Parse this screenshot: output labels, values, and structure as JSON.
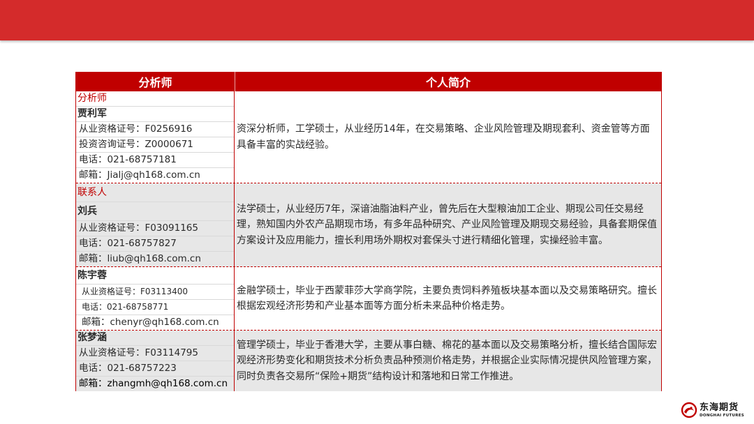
{
  "header": {
    "col_left": "分析师",
    "col_right": "个人简介"
  },
  "rows": [
    {
      "lines": [
        "分析师",
        "贾利军",
        "从业资格证号：F0256916",
        "投资咨询证号：Z0000671",
        "电话：021-68757181",
        "邮箱：Jialj@qh168.com.cn"
      ],
      "bio": "资深分析师，工学硕士，从业经历14年，在交易策略、企业风险管理及期现套利、资金管等方面具备丰富的实战经验。"
    },
    {
      "lines": [
        "联系人",
        "刘兵",
        "从业资格证号：F03091165",
        "电话：021-68757827",
        "邮箱：liub@qh168.com.cn"
      ],
      "bio": "法学硕士，从业经历7年，深谙油脂油料产业，曾先后在大型粮油加工企业、期现公司任交易经理，熟知国内外农产品期现市场，有多年品种研究、产业风险管理及期现交易经验，具备套期保值方案设计及应用能力，擅长利用场外期权对套保头寸进行精细化管理，实操经验丰富。"
    },
    {
      "lines": [
        "陈宇蓉",
        "从业资格证号：F03113400",
        "电话：021-68758771",
        "邮箱：chenyr@qh168.com.cn"
      ],
      "bio": "金融学硕士，毕业于西蒙菲莎大学商学院，主要负责饲料养殖板块基本面以及交易策略研究。擅长根据宏观经济形势和产业基本面等方面分析未来品种价格走势。"
    },
    {
      "lines": [
        "张梦涵",
        "从业资格证号：F03114795",
        "电话：021-68757223",
        "邮箱：zhangmh@qh168.com.cn"
      ],
      "bio": "管理学硕士，毕业于香港大学，主要从事白糖、棉花的基本面以及交易策略分析，擅长结合国际宏观经济形势变化和期货技术分析负责品种预测价格走势，并根据企业实际情况提供风险管理方案，同时负责各交易所“保险+期货”结构设计和落地和日常工作推进。"
    }
  ],
  "logo": {
    "cn": "东海期货",
    "en": "DONGHAI FUTURES"
  },
  "colors": {
    "brand_red": "#c00000",
    "top_bar": "#d42b2b",
    "shade": "#e7e7e7"
  }
}
